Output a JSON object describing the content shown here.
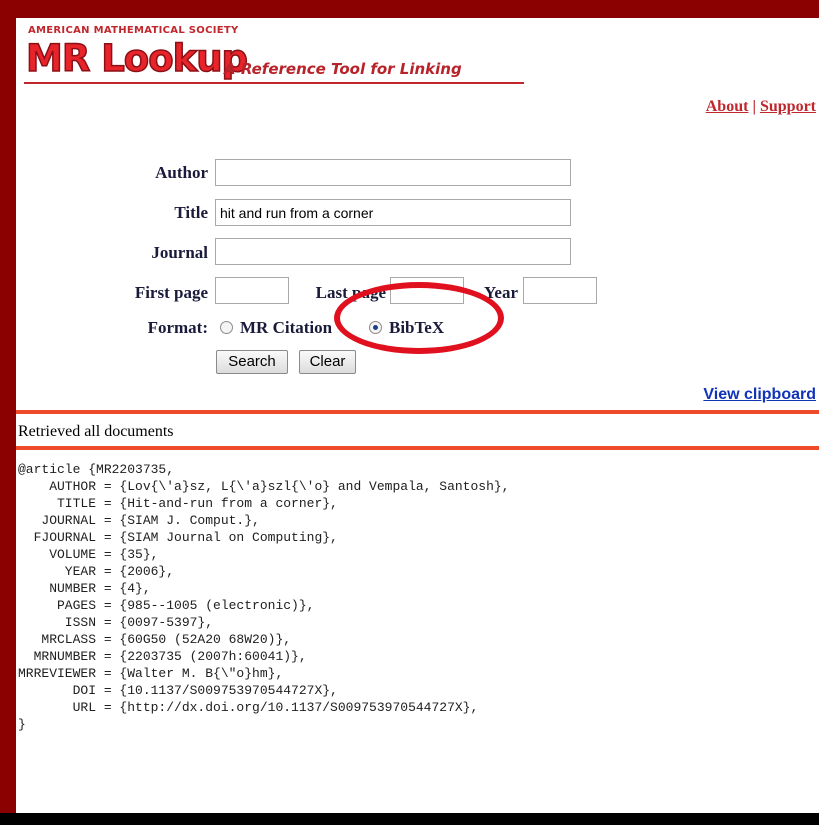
{
  "header": {
    "org": "AMERICAN MATHEMATICAL SOCIETY",
    "app_name": "MR Lookup",
    "tagline": "A Reference Tool for Linking"
  },
  "top_links": {
    "about": "About",
    "separator": "|",
    "support": "Support"
  },
  "form": {
    "author_label": "Author",
    "author_value": "",
    "title_label": "Title",
    "title_value": "hit and run from a corner",
    "journal_label": "Journal",
    "journal_value": "",
    "first_page_label": "First page",
    "first_page_value": "",
    "last_page_label": "Last page",
    "last_page_value": "",
    "year_label": "Year",
    "year_value": "",
    "format_label": "Format:",
    "format_options": [
      "MR Citation",
      "BibTeX"
    ],
    "format_selected": "BibTeX",
    "search_label": "Search",
    "clear_label": "Clear"
  },
  "view_clipboard": "View clipboard",
  "status": "Retrieved all documents",
  "result": {
    "bibtex": "@article {MR2203735,\n    AUTHOR = {Lov{\\'a}sz, L{\\'a}szl{\\'o} and Vempala, Santosh},\n     TITLE = {Hit-and-run from a corner},\n   JOURNAL = {SIAM J. Comput.},\n  FJOURNAL = {SIAM Journal on Computing},\n    VOLUME = {35},\n      YEAR = {2006},\n    NUMBER = {4},\n     PAGES = {985--1005 (electronic)},\n      ISSN = {0097-5397},\n   MRCLASS = {60G50 (52A20 68W20)},\n  MRNUMBER = {2203735 (2007h:60041)},\nMRREVIEWER = {Walter M. B{\\\"o}hm},\n       DOI = {10.1137/S009753970544727X},\n       URL = {http://dx.doi.org/10.1137/S009753970544727X},\n}"
  },
  "colors": {
    "frame": "#8b0000",
    "brand_red": "#e8242b",
    "rule": "#ef4a2a",
    "link_blue": "#1033b8",
    "annotation_ring": "#e0101e"
  }
}
